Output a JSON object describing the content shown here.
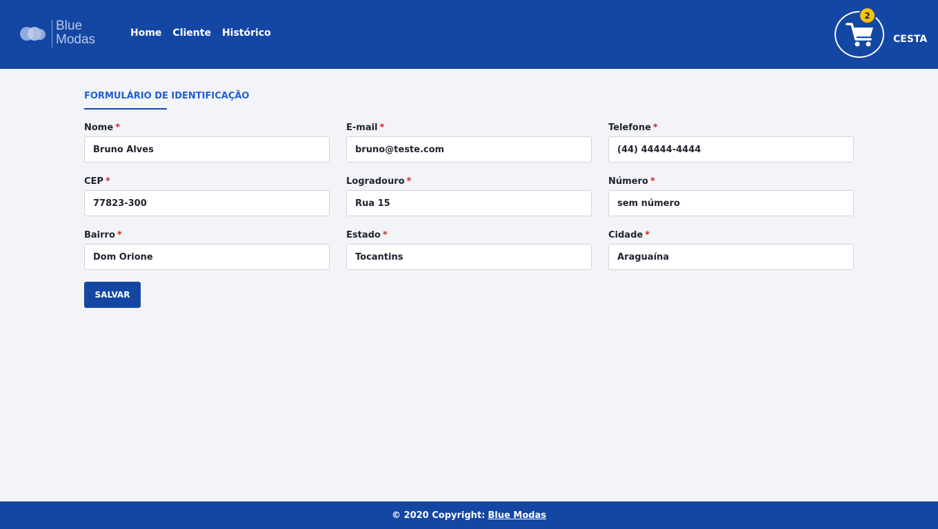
{
  "header": {
    "logo_line1": "Blue",
    "logo_line2": "Modas",
    "nav": [
      {
        "label": "Home"
      },
      {
        "label": "Cliente"
      },
      {
        "label": "Histórico"
      }
    ],
    "cart": {
      "count": "2",
      "label": "CESTA",
      "icon": "shopping-cart-icon"
    }
  },
  "form": {
    "title": "FORMULÁRIO DE IDENTIFICAÇÃO",
    "required_marker": "*",
    "fields": {
      "nome": {
        "label": "Nome",
        "value": "Bruno Alves"
      },
      "email": {
        "label": "E-mail",
        "value": "bruno@teste.com"
      },
      "telefone": {
        "label": "Telefone",
        "value": "(44) 44444-4444"
      },
      "cep": {
        "label": "CEP",
        "value": "77823-300"
      },
      "logradouro": {
        "label": "Logradouro",
        "value": "Rua 15"
      },
      "numero": {
        "label": "Número",
        "value": "sem número"
      },
      "bairro": {
        "label": "Bairro",
        "value": "Dom Orione"
      },
      "estado": {
        "label": "Estado",
        "value": "Tocantins"
      },
      "cidade": {
        "label": "Cidade",
        "value": "Araguaína"
      }
    },
    "save_label": "SALVAR"
  },
  "footer": {
    "copyright": "© 2020 Copyright:",
    "brand_link": "Blue Modas"
  },
  "colors": {
    "brand_blue": "#1447a3",
    "accent_blue": "#1e5fd1",
    "badge_yellow": "#f7c20c",
    "required_red": "#d0242f",
    "background": "#f3f4f7"
  }
}
